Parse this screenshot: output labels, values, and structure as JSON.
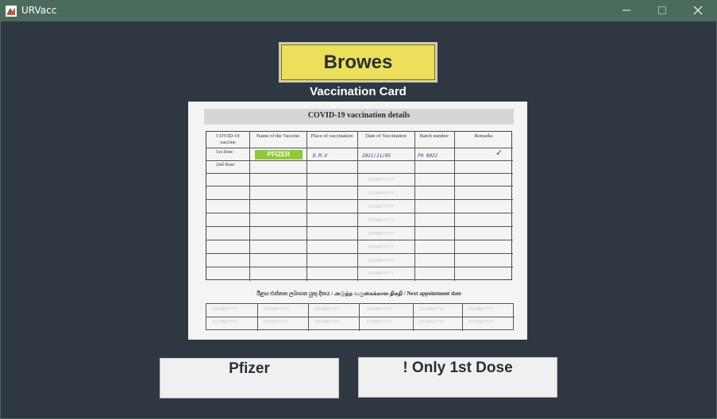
{
  "window": {
    "title": "URVacc",
    "icons": {
      "app": "matlab-logo-icon",
      "minimize": "minimize-icon",
      "maximize": "maximize-icon",
      "close": "close-icon"
    }
  },
  "browse_button": {
    "label": "Browes",
    "color": "#ebdf5b"
  },
  "card": {
    "heading": "Vaccination Card",
    "image": {
      "title": "COVID-19 vaccination details",
      "columns": [
        "COVID-19 vaccine",
        "Name of the Vaccine",
        "Place of vaccination",
        "Date of Vaccination",
        "Batch number",
        "Remarks"
      ],
      "rows": [
        {
          "dose": "1st dose",
          "vaccine": "PFIZER",
          "place": "D.M.V",
          "date": "2021/11/05",
          "batch": "FH 8022",
          "remarks": "✓"
        },
        {
          "dose": "2nd dose",
          "vaccine": "",
          "place": "",
          "date": "",
          "batch": "",
          "remarks": ""
        }
      ],
      "date_placeholder": "DD/MM/YYYY",
      "next_appointment": "ඊළඟ එන්නත ලබාගත යුතු දිනය / அடுத்த வருகைக்கான திகதி / Next appointment date"
    }
  },
  "results": {
    "vaccine_name": "Pfizer",
    "dose_status": "! Only 1st Dose"
  }
}
